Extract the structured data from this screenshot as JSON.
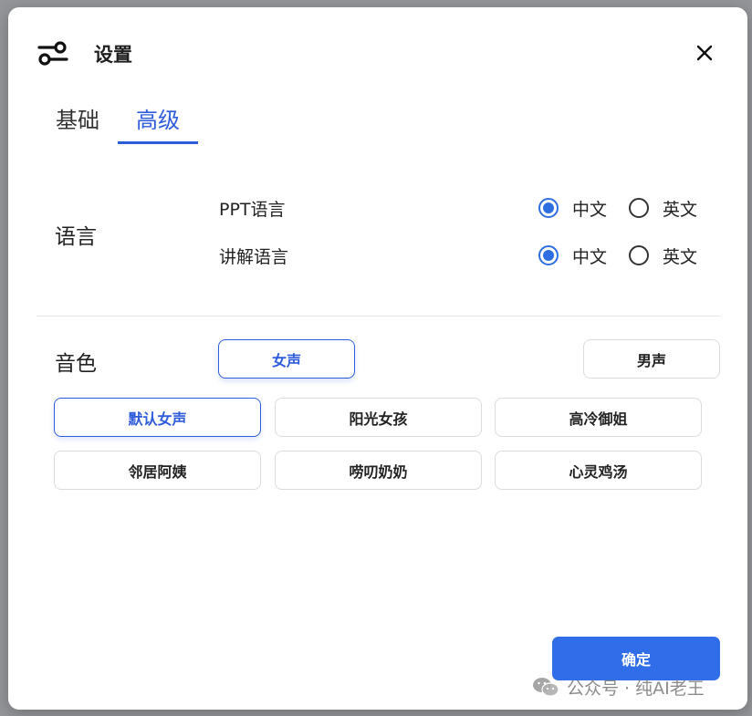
{
  "dialog": {
    "title": "设置",
    "icon": "settings-sliders-icon",
    "close_icon": "close-icon"
  },
  "tabs": [
    {
      "label": "基础",
      "active": false
    },
    {
      "label": "高级",
      "active": true
    }
  ],
  "language": {
    "section_label": "语言",
    "rows": [
      {
        "label": "PPT语言",
        "options": [
          "中文",
          "英文"
        ],
        "selected": "中文"
      },
      {
        "label": "讲解语言",
        "options": [
          "中文",
          "英文"
        ],
        "selected": "中文"
      }
    ]
  },
  "voice": {
    "section_label": "音色",
    "gender": {
      "female": "女声",
      "male": "男声",
      "selected": "女声"
    },
    "presets": [
      "默认女声",
      "阳光女孩",
      "高冷御姐",
      "邻居阿姨",
      "唠叨奶奶",
      "心灵鸡汤"
    ],
    "selected_preset": "默认女声"
  },
  "footer": {
    "confirm_label": "确定",
    "watermark_text": "公众号 · 纯AI老王",
    "watermark_icon": "wechat-icon"
  },
  "colors": {
    "accent": "#2f5cdb",
    "primary_button": "#2f6ee8",
    "radio": "#2f6ee0"
  }
}
